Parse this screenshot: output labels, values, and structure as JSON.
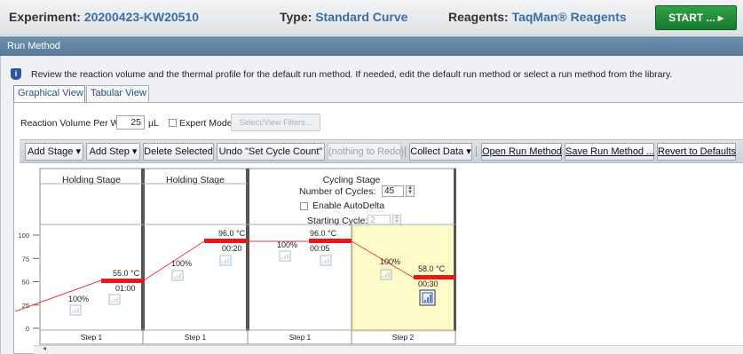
{
  "header": {
    "experiment_label": "Experiment:",
    "experiment_value": "20200423-KW20510",
    "type_label": "Type:",
    "type_value": "Standard Curve",
    "reagents_label": "Reagents:",
    "reagents_value": "TaqMan® Reagents",
    "start_button": "START ... ▸"
  },
  "panel": {
    "title": "Run Method",
    "info_text": "Review the reaction volume and the thermal profile for the default run method. If needed, edit the default run method or select a run method from the library."
  },
  "tabs": [
    {
      "label": "Graphical View",
      "active": true
    },
    {
      "label": "Tabular View",
      "active": false
    }
  ],
  "settings": {
    "reaction_volume_label": "Reaction Volume Per Well",
    "reaction_volume_value": "25",
    "reaction_volume_unit": "µL",
    "expert_mode_label": "Expert Mode",
    "expert_mode_checked": false,
    "filters_button": "Select/View Filters..."
  },
  "toolbar": {
    "add_stage": "Add Stage ▾",
    "add_step": "Add Step ▾",
    "delete_selected": "Delete Selected",
    "undo": "Undo \"Set Cycle Count\"",
    "redo": "(nothing to Redo)",
    "collect_data": "Collect Data ▾",
    "open_run_method": "Open Run Method",
    "save_run_method": "Save Run Method ...",
    "revert": "Revert to Defaults"
  },
  "y_axis": {
    "ticks": [
      "100",
      "75",
      "50",
      "25",
      "0"
    ]
  },
  "stages": [
    {
      "title": "Holding Stage",
      "steps": [
        {
          "label": "Step 1",
          "temp": "55.0 °C",
          "time": "01:00",
          "ramp": "100%"
        }
      ]
    },
    {
      "title": "Holding Stage",
      "steps": [
        {
          "label": "Step 1",
          "temp": "96.0 °C",
          "time": "00:20",
          "ramp": "100%"
        }
      ]
    },
    {
      "title": "Cycling Stage",
      "cycles_label": "Number of Cycles:",
      "cycles_value": "45",
      "autodelta_label": "Enable AutoDelta",
      "autodelta_checked": false,
      "starting_cycle_label": "Starting Cycle:",
      "starting_cycle_value": "2",
      "steps": [
        {
          "label": "Step 1",
          "temp": "96.0 °C",
          "time": "00:05",
          "ramp": "100%"
        },
        {
          "label": "Step 2",
          "temp": "58.0 °C",
          "time": "00:30",
          "ramp": "100%",
          "selected": true
        }
      ]
    }
  ],
  "colors": {
    "accent_blue": "#3a6ea5",
    "start_green": "#1e8f3a",
    "temp_bar_red": "#e81818",
    "ramp_line_red": "#e33a3a",
    "selected_step_bg": "#fefbc8"
  }
}
